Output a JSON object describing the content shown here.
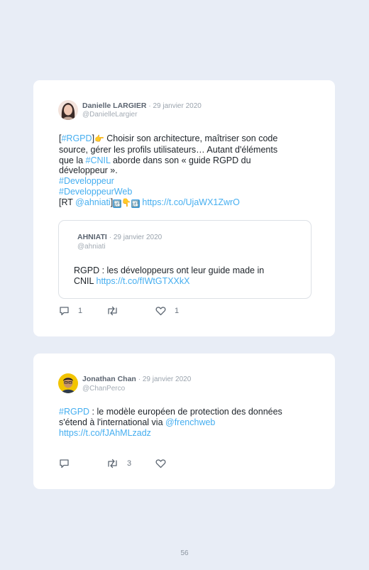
{
  "tweets": [
    {
      "author": "Danielle LARGIER",
      "date": "· 29 janvier 2020",
      "handle": "@DanielleLargier",
      "text": {
        "l1_open": "[",
        "l1_tag": "#RGPD",
        "l1_close": "]",
        "l1_emoji": "👉",
        "l1_rest": " Choisir son architecture, maîtriser son code",
        "l2": "source, gérer les profils utilisateurs… Autant d'éléments",
        "l3_a": "que la ",
        "l3_tag": "#CNIL",
        "l3_b": " aborde dans son « guide RGPD du",
        "l4": "développeur ».",
        "l5_tag": "#Developpeur",
        "l6_tag": "#DeveloppeurWeb",
        "l7_a": "[RT ",
        "l7_mention": "@ahniati",
        "l7_b": "]",
        "l7_emoji1": "🔃",
        "l7_emoji2": "👇",
        "l7_emoji3": "🔃",
        "l7_link": "https://t.co/UjaWX1ZwrO"
      },
      "quote": {
        "author": "AHNIATI",
        "date": "· 29 janvier 2020",
        "handle": "@ahniati",
        "text_l1": "RGPD : les développeurs ont leur guide made in",
        "text_l2_a": "CNIL ",
        "text_l2_link": "https://t.co/fIWtGTXXkX"
      },
      "replies": "1",
      "retweets": "",
      "likes": "1"
    },
    {
      "author": "Jonathan Chan",
      "date": "· 29 janvier 2020",
      "handle": "@ChanPerco",
      "text": {
        "l1_tag": "#RGPD",
        "l1_rest": " : le modèle européen de protection des données",
        "l2_a": "s'étend à l'international via ",
        "l2_mention": "@frenchweb",
        "l3_link": "https://t.co/fJAhMLzadz"
      },
      "replies": "",
      "retweets": "3",
      "likes": ""
    }
  ],
  "page_number": "56",
  "colors": {
    "background": "#e8edf6",
    "card": "#ffffff",
    "link": "#45aef0"
  }
}
